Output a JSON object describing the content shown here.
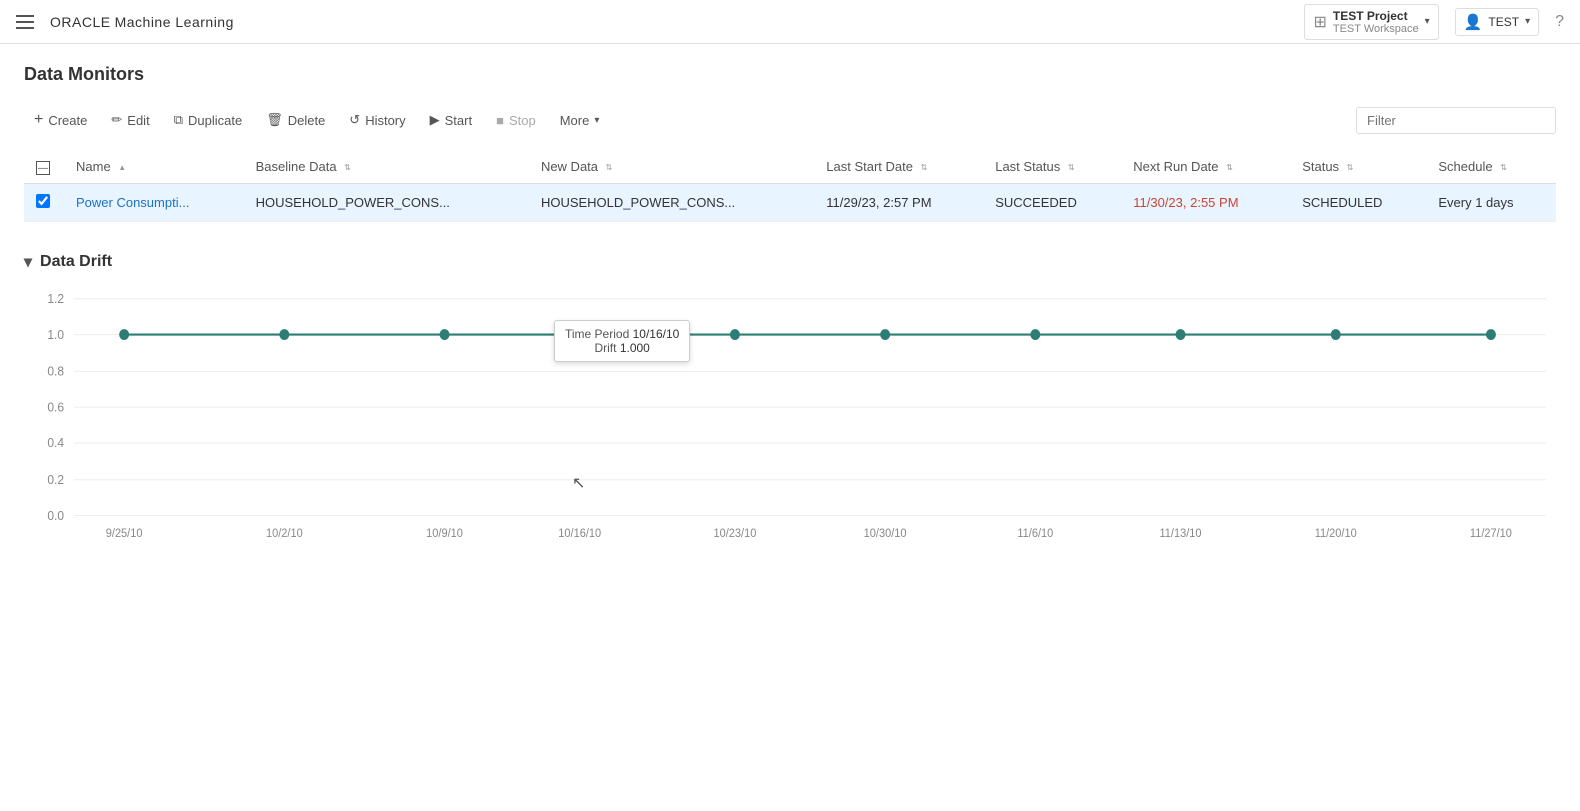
{
  "app": {
    "title": "ORACLE Machine Learning",
    "oracle_brand": "ORACLE",
    "oracle_subtitle": "Machine Learning"
  },
  "header": {
    "project_label": "TEST Project",
    "workspace_label": "TEST Workspace",
    "user_label": "TEST"
  },
  "toolbar": {
    "create_label": "Create",
    "edit_label": "Edit",
    "duplicate_label": "Duplicate",
    "delete_label": "Delete",
    "history_label": "History",
    "start_label": "Start",
    "stop_label": "Stop",
    "more_label": "More",
    "filter_placeholder": "Filter"
  },
  "page": {
    "title": "Data Monitors"
  },
  "table": {
    "columns": [
      "Name",
      "Baseline Data",
      "New Data",
      "Last Start Date",
      "Last Status",
      "Next Run Date",
      "Status",
      "Schedule"
    ],
    "rows": [
      {
        "name": "Power Consumpti...",
        "baseline": "HOUSEHOLD_POWER_CONS...",
        "new_data": "HOUSEHOLD_POWER_CONS...",
        "last_start": "11/29/23, 2:57 PM",
        "last_status": "SUCCEEDED",
        "next_run": "11/30/23, 2:55 PM",
        "status": "SCHEDULED",
        "schedule": "Every 1 days",
        "selected": true
      }
    ]
  },
  "chart": {
    "section_title": "Data Drift",
    "tooltip": {
      "time_period_label": "Time Period",
      "time_period_value": "10/16/10",
      "drift_label": "Drift",
      "drift_value": "1.000"
    },
    "y_labels": [
      "1.2",
      "1.0",
      "0.8",
      "0.6",
      "0.4",
      "0.2",
      "0.0"
    ],
    "x_labels": [
      "9/25/10",
      "10/2/10",
      "10/9/10",
      "10/16/10",
      "10/23/10",
      "10/30/10",
      "11/6/10",
      "11/13/10",
      "11/20/10",
      "11/27/10"
    ],
    "line_color": "#2d7d74",
    "accent_color": "#c74634"
  }
}
